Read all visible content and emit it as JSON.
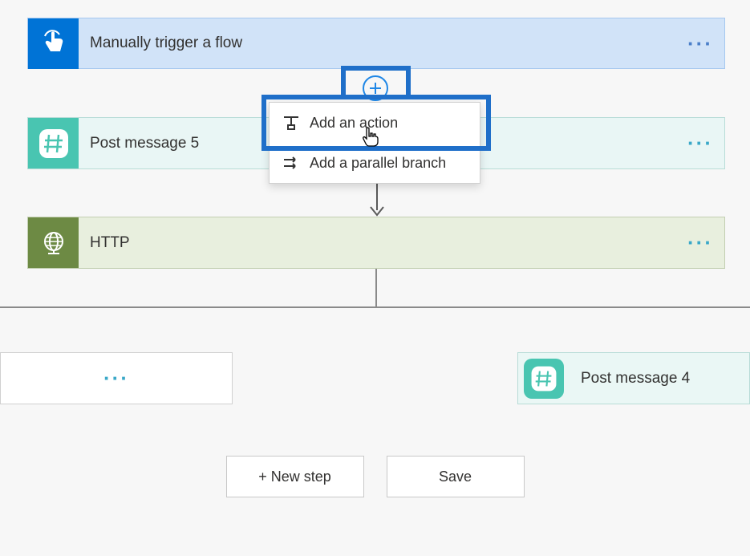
{
  "trigger": {
    "title": "Manually trigger a flow",
    "icon": "touch-icon"
  },
  "action1": {
    "title": "Post message 5",
    "icon": "hash-icon"
  },
  "action2": {
    "title": "HTTP",
    "icon": "globe-icon"
  },
  "branch_right": {
    "title": "Post message 4",
    "icon": "hash-icon"
  },
  "plus_menu": {
    "add_action": "Add an action",
    "add_parallel": "Add a parallel branch"
  },
  "buttons": {
    "new_step": "+ New step",
    "save": "Save"
  },
  "colors": {
    "highlight": "#1f6fc9",
    "trigger_icon_bg": "#0073d6",
    "slack_icon_bg": "#49c5b1",
    "http_icon_bg": "#6d8a44"
  }
}
